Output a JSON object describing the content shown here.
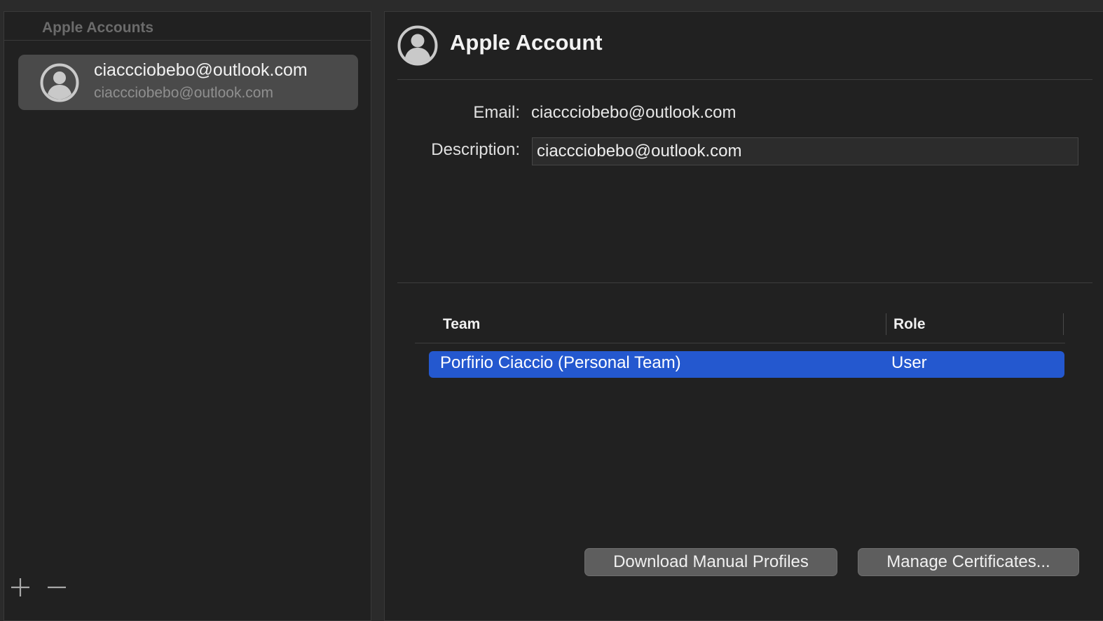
{
  "sidebar": {
    "header": "Apple Accounts",
    "accounts": [
      {
        "primary": "ciaccciobebo@outlook.com",
        "secondary": "ciaccciobebo@outlook.com",
        "icon": "person-circle-icon",
        "selected": true
      }
    ],
    "add_icon": "plus-icon",
    "remove_icon": "minus-icon"
  },
  "detail": {
    "title": "Apple Account",
    "icon": "person-circle-icon",
    "email_label": "Email:",
    "email_value": "ciaccciobebo@outlook.com",
    "description_label": "Description:",
    "description_value": "ciaccciobebo@outlook.com"
  },
  "teams_table": {
    "columns": [
      "Team",
      "Role"
    ],
    "rows": [
      {
        "team": "Porfirio Ciaccio (Personal Team)",
        "role": "User",
        "selected": true
      }
    ]
  },
  "buttons": {
    "download_profiles": "Download Manual Profiles",
    "manage_certificates": "Manage Certificates..."
  },
  "colors": {
    "selection_blue": "#2458cf",
    "panel_background": "#212121",
    "selected_account_row": "#4a4a4a"
  }
}
